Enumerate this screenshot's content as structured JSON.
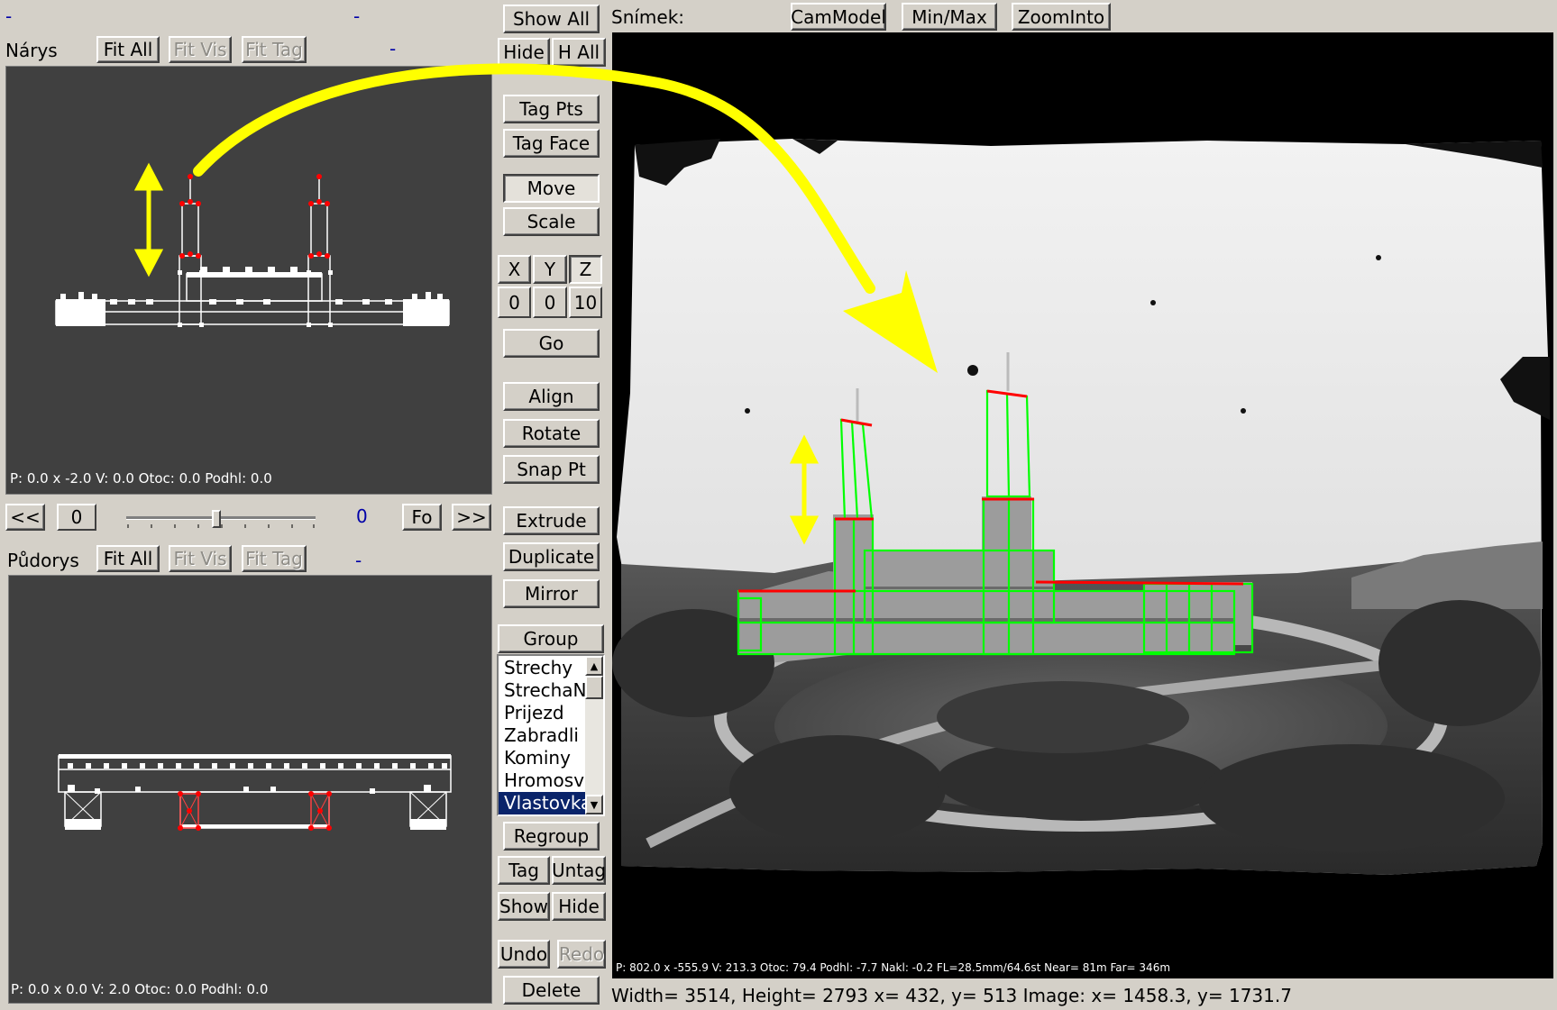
{
  "top": {
    "dash_left": "-",
    "dash_mid": "-",
    "snimek_label": "Snímek:"
  },
  "narys": {
    "title": "Nárys",
    "dash": "-",
    "fit_all": "Fit All",
    "fit_vis": "Fit Vis",
    "fit_tag": "Fit Tag",
    "status": "P: 0.0 x -2.0  V: 0.0  Otoc: 0.0   Podhl: 0.0"
  },
  "pudorys": {
    "title": "Půdorys",
    "dash": "-",
    "fit_all": "Fit All",
    "fit_vis": "Fit Vis",
    "fit_tag": "Fit Tag",
    "status": "P: 0.0 x 0.0  V: 2.0  Otoc: 0.0   Podhl: 0.0"
  },
  "nav": {
    "prev": "<<",
    "field": "0",
    "value": "0",
    "fo": "Fo",
    "next": ">>",
    "slider_level": 0.5
  },
  "tools": {
    "show_all": "Show All",
    "hide": "Hide",
    "h_all": "H All",
    "tag_pts": "Tag Pts",
    "tag_face": "Tag Face",
    "move": "Move",
    "scale": "Scale",
    "x": "X",
    "y": "Y",
    "z": "Z",
    "vx": "0",
    "vy": "0",
    "vz": "10",
    "go": "Go",
    "align": "Align",
    "rotate": "Rotate",
    "snap_pt": "Snap Pt",
    "extrude": "Extrude",
    "duplicate": "Duplicate",
    "mirror": "Mirror",
    "group": "Group",
    "regroup": "Regroup",
    "tag": "Tag",
    "untag": "Untag",
    "show": "Show",
    "hide2": "Hide",
    "undo": "Undo",
    "redo": "Redo",
    "delete": "Delete"
  },
  "groups": {
    "items": [
      "Strechy",
      "StrechaNa",
      "Prijezd",
      "Zabradli",
      "Kominy",
      "Hromosvo",
      "Vlastovka"
    ],
    "selected_index": 6
  },
  "photo": {
    "cammodel": "CamModel",
    "minmax": "Min/Max",
    "zoominto": "ZoomInto",
    "status": "P: 802.0 x -555.9  V: 213.3  Otoc: 79.4   Podhl: -7.7   Nakl: -0.2   FL=28.5mm/64.6st   Near= 81m   Far= 346m"
  },
  "bottom": {
    "info": "Width= 3514, Height= 2793   x= 432, y= 513   Image: x= 1458.3, y= 1731.7"
  },
  "colors": {
    "accent_arrow": "#ffff00",
    "wire_green": "#00ff00",
    "vertex_red": "#ff0000",
    "view_bg": "#404040"
  }
}
